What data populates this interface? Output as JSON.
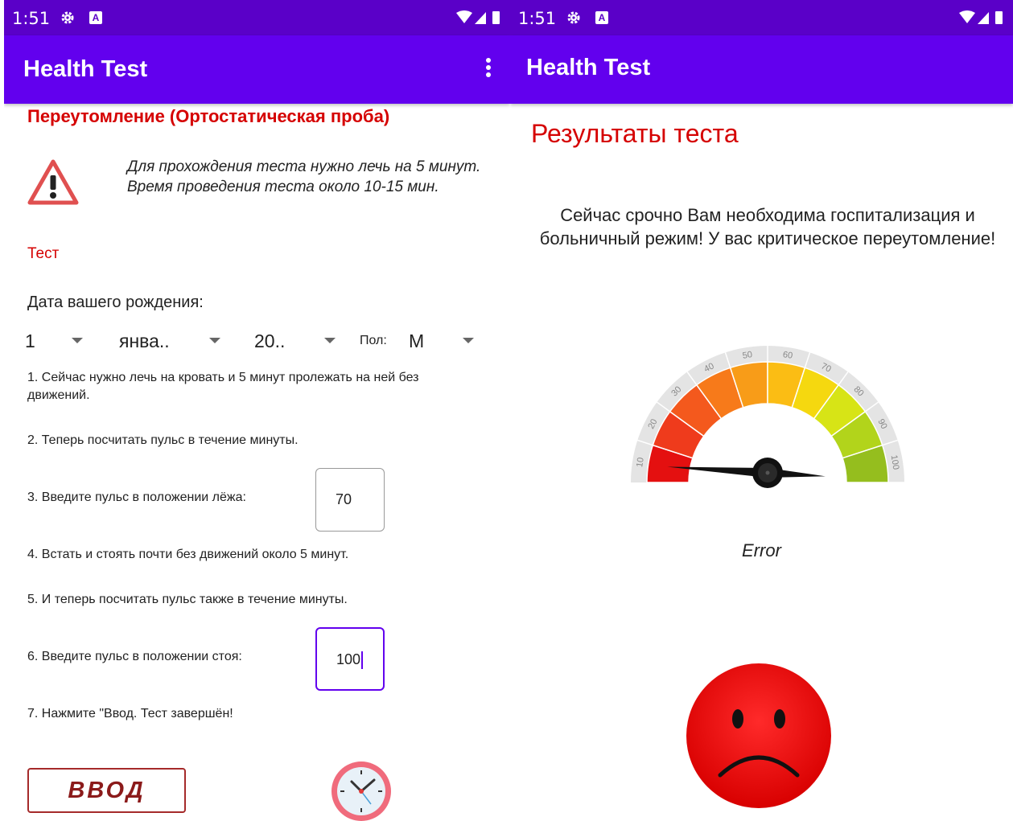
{
  "left_screen": {
    "status": {
      "time": "1:51",
      "app_badge": "A"
    },
    "app_title": "Health Test",
    "heading": "Переутомление (Ортостатическая проба)",
    "warning_text": "Для прохождения теста нужно лечь на 5 минут. Время проведения теста около 10-15 мин.",
    "test_label": "Тест",
    "birth_label": "Дата вашего рождения:",
    "spinners": {
      "day": "1",
      "month": "янва..",
      "year": "20..",
      "gender_label": "Пол:",
      "gender": "М"
    },
    "steps": {
      "s1": "1. Сейчас нужно лечь на кровать и 5 минут пролежать на ней без движений.",
      "s2": "2. Теперь посчитать пульс в течение минуты.",
      "s3": "3. Введите пульс в положении лёжа:",
      "s4": "4. Встать и стоять почти без движений около 5 минут.",
      "s5": "5. И теперь посчитать пульс также в течение минуты.",
      "s6": "6. Введите пульс в положении стоя:",
      "s7": "7. Нажмите \"Ввод. Тест завершён!"
    },
    "pulse_lying": "70",
    "pulse_standing": "100",
    "submit_label": "ВВОД"
  },
  "right_screen": {
    "status": {
      "time": "1:51",
      "app_badge": "A"
    },
    "app_title": "Health Test",
    "result_title": "Результаты теста",
    "result_text": "Сейчас срочно Вам необходима госпитализация и больничный режим! У вас критическое переутомление!",
    "gauge": {
      "ticks": [
        "10",
        "20",
        "30",
        "40",
        "50",
        "60",
        "70",
        "80",
        "90",
        "100"
      ],
      "colors": [
        "#e41010",
        "#ef3b1c",
        "#f4591d",
        "#f77a1a",
        "#f89c18",
        "#fbbd14",
        "#f5d80f",
        "#d7e416",
        "#b2d41b",
        "#95be1e"
      ],
      "value": 0,
      "label": "Error"
    }
  },
  "colors": {
    "status_bar": "#5a00c8",
    "app_bar": "#6200ee",
    "accent_red": "#d50000"
  }
}
